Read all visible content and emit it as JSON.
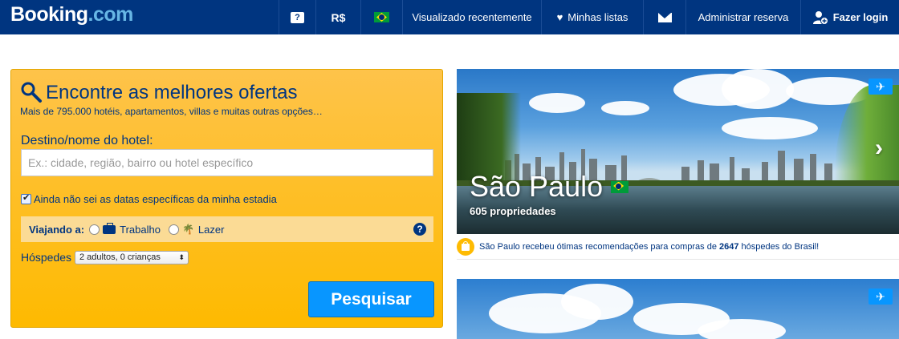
{
  "header": {
    "logo_main": "Booking",
    "logo_dot": ".com",
    "help_icon_text": "?",
    "currency": "R$",
    "recently_viewed": "Visualizado recentemente",
    "my_lists": "Minhas listas",
    "manage_booking": "Administrar reserva",
    "login": "Fazer login",
    "bg_color": "#003580"
  },
  "search": {
    "title": "Encontre as melhores ofertas",
    "subtitle": "Mais de 795.000 hotéis, apartamentos, villas e muitas outras opções…",
    "destination_label": "Destino/nome do hotel:",
    "destination_placeholder": "Ex.: cidade, região, bairro ou hotel específico",
    "destination_value": "",
    "no_dates_label": "Ainda não sei as datas específicas da minha estadia",
    "no_dates_checked": true,
    "travel_label": "Viajando a:",
    "travel_work": "Trabalho",
    "travel_leisure": "Lazer",
    "help_mark": "?",
    "guests_label": "Hóspedes",
    "guests_value": "2 adultos, 0 crianças",
    "submit": "Pesquisar",
    "panel_color": "#febb02",
    "button_color": "#0896ff"
  },
  "featured": {
    "city": "São Paulo",
    "properties": "605 propriedades",
    "next_arrow": "›",
    "plane_icon": "✈",
    "recommend_prefix": "São Paulo recebeu ótimas recomendações para compras de ",
    "recommend_count": "2647",
    "recommend_suffix": " hóspedes do Brasil!"
  }
}
